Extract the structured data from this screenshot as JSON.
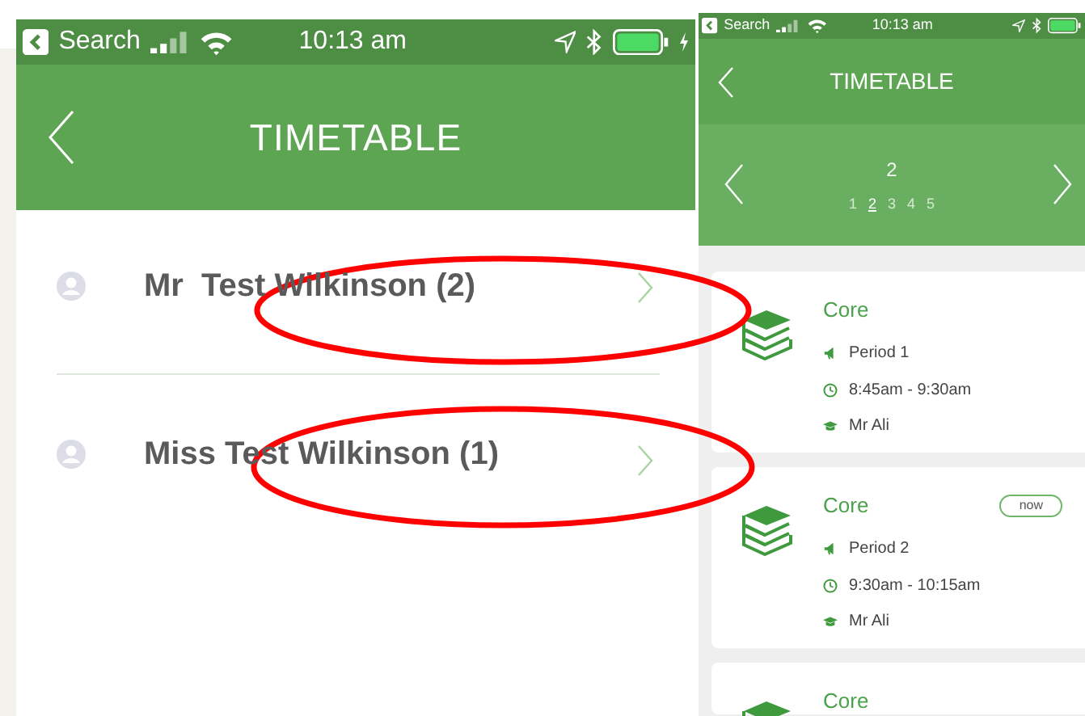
{
  "left_screen": {
    "status_bar": {
      "back_label": "Search",
      "time": "10:13 am"
    },
    "header": {
      "title": "TIMETABLE"
    },
    "people": [
      {
        "name": "Mr  Test Wilkinson (2)"
      },
      {
        "name": "Miss Test Wilkinson (1)"
      }
    ]
  },
  "right_screen": {
    "status_bar": {
      "back_label": "Search",
      "time": "10:13 am"
    },
    "header": {
      "title": "TIMETABLE"
    },
    "week_pager": {
      "current": "2",
      "weeks": [
        {
          "label": "1",
          "selected": false
        },
        {
          "label": "2",
          "selected": true
        },
        {
          "label": "3",
          "selected": false
        },
        {
          "label": "4",
          "selected": false
        },
        {
          "label": "5",
          "selected": false
        }
      ]
    },
    "lessons": [
      {
        "subject": "Core",
        "period": "Period 1",
        "time": "8:45am - 9:30am",
        "teacher": "Mr Ali"
      },
      {
        "subject": "Core",
        "badge": "now",
        "period": "Period 2",
        "time": "9:30am - 10:15am",
        "teacher": "Mr Ali"
      },
      {
        "subject": "Core"
      }
    ]
  },
  "annotations": [
    {
      "kind": "ellipse"
    },
    {
      "kind": "ellipse"
    }
  ]
}
